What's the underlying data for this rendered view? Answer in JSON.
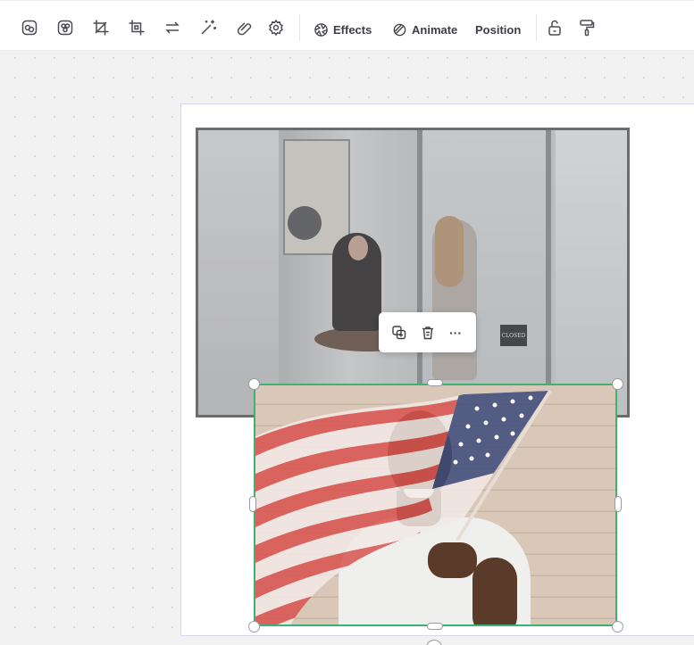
{
  "toolbar": {
    "icons": [
      "filter-icon",
      "color-adjust-icon",
      "crop-icon",
      "frame-crop-icon",
      "flip-icon",
      "magic-wand-icon",
      "link-icon",
      "settings-icon",
      "lock-open-icon",
      "paint-roller-icon"
    ],
    "effects_label": "Effects",
    "animate_label": "Animate",
    "position_label": "Position"
  },
  "canvas": {
    "photo_top_sign": "CLOSED",
    "selection_color": "#3cb371"
  },
  "context_menu": {
    "icons": [
      "duplicate-icon",
      "delete-icon",
      "more-icon"
    ],
    "more_glyph": "···"
  }
}
